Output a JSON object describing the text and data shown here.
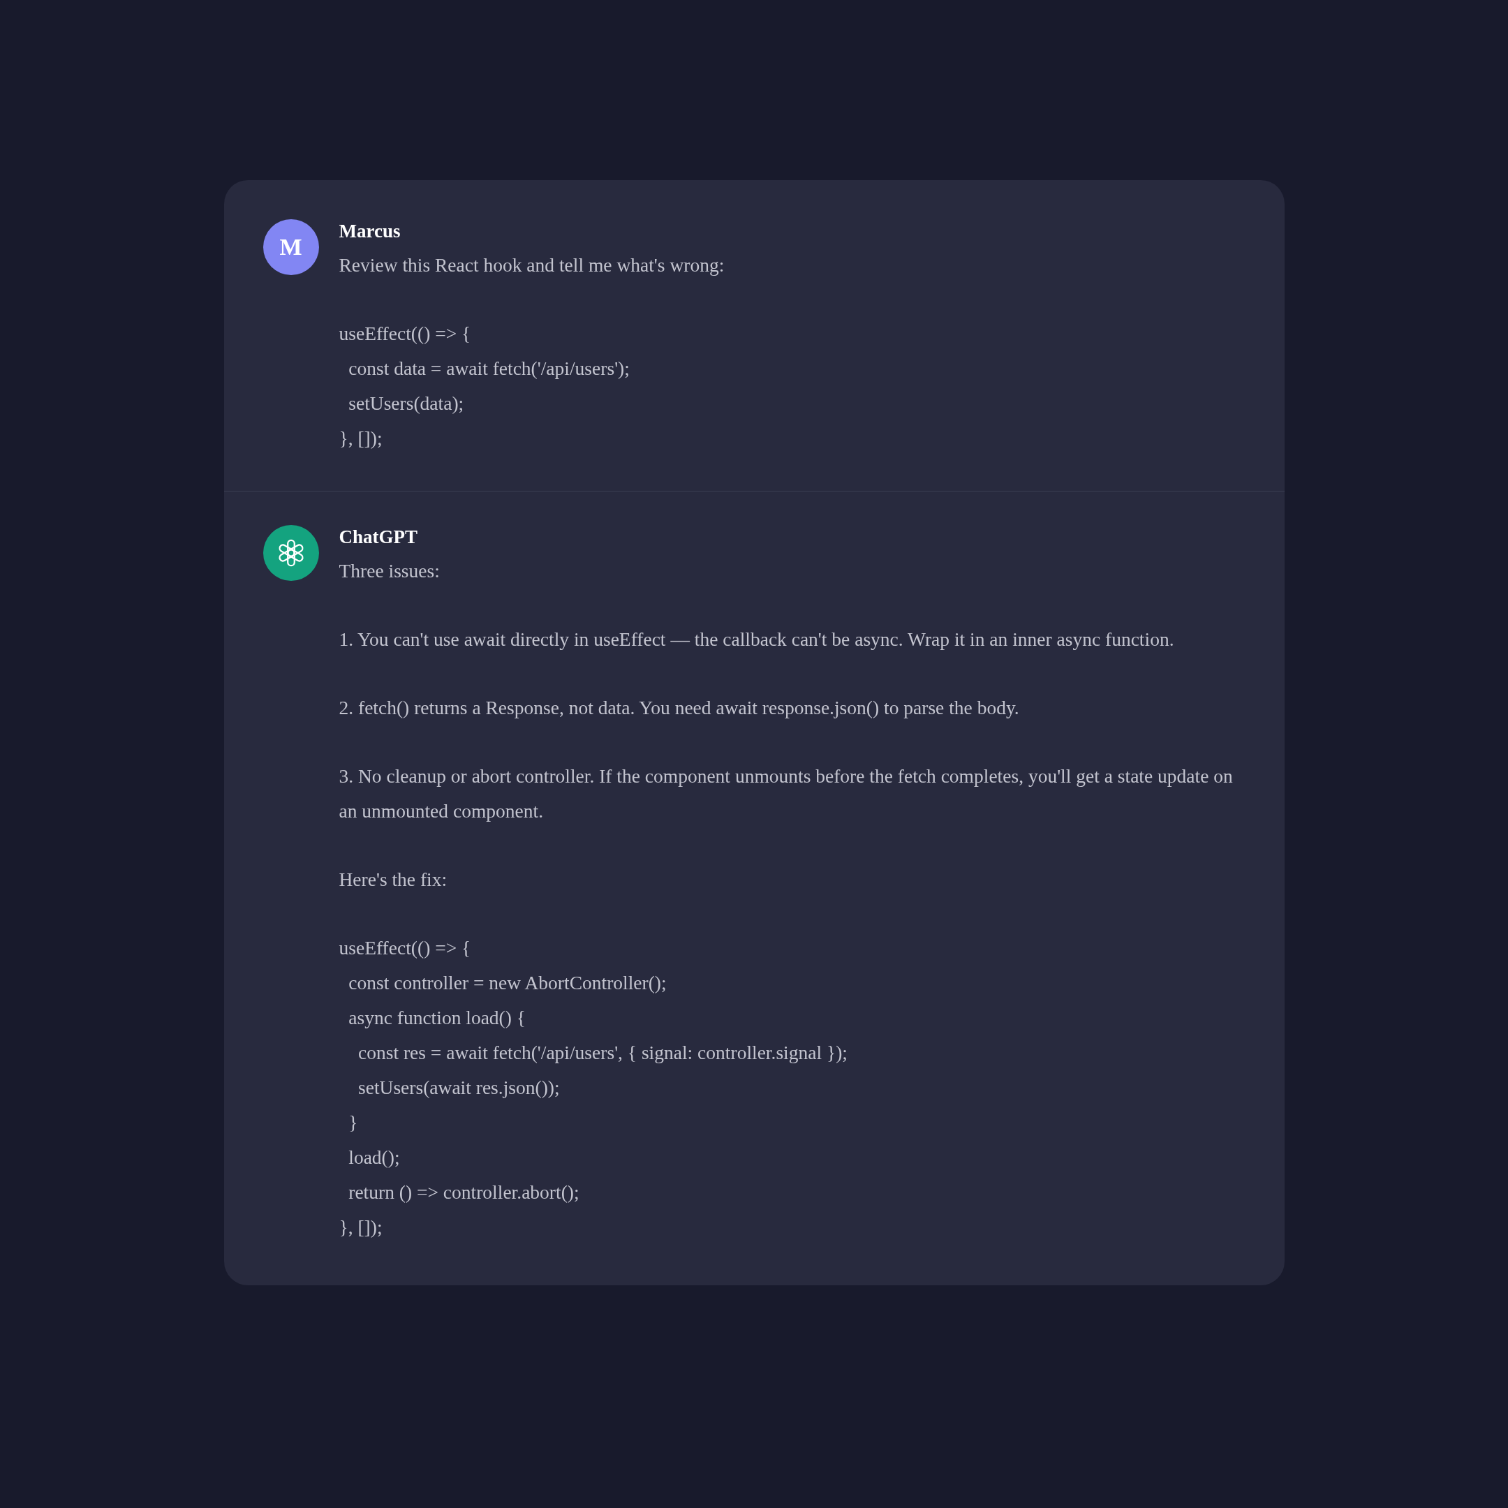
{
  "messages": [
    {
      "author": "Marcus",
      "avatar": {
        "kind": "letter",
        "text": "M",
        "color": "#8286f3"
      },
      "paragraphs": [
        "Review this React hook and tell me what's wrong:",
        "useEffect(() => {\n  const data = await fetch('/api/users');\n  setUsers(data);\n}, []);"
      ]
    },
    {
      "author": "ChatGPT",
      "avatar": {
        "kind": "logo",
        "color": "#14a37f"
      },
      "paragraphs": [
        "Three issues:",
        "1. You can't use await directly in useEffect — the callback can't be async. Wrap it in an inner async function.",
        "2. fetch() returns a Response, not data. You need await response.json() to parse the body.",
        "3. No cleanup or abort controller. If the component unmounts before the fetch completes, you'll get a state update on an unmounted component.",
        "Here's the fix:",
        "useEffect(() => {\n  const controller = new AbortController();\n  async function load() {\n    const res = await fetch('/api/users', { signal: controller.signal });\n    setUsers(await res.json());\n  }\n  load();\n  return () => controller.abort();\n}, []);"
      ]
    }
  ]
}
